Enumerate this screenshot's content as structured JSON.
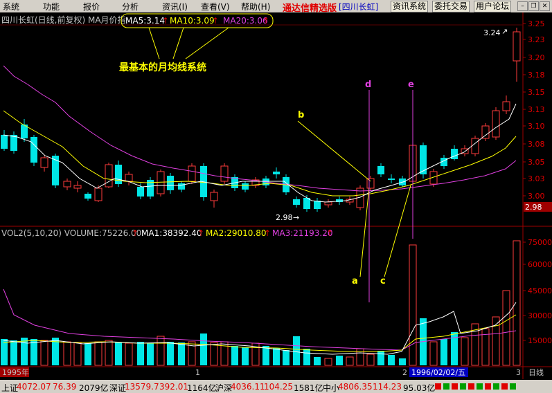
{
  "menu": {
    "items": [
      "系统",
      "功能",
      "报价",
      "分析",
      "资讯(I)",
      "查看(V)",
      "帮助(H)"
    ],
    "title": "通达信精选版",
    "stock": "[四川长虹]",
    "buttons": [
      "资讯系统",
      "委托交易",
      "用户论坛"
    ]
  },
  "chart": {
    "header_left": "四川长虹(日线,前复权) MA月价指",
    "ma5": "MA5:3.14",
    "ma10": "MA10:3.09",
    "ma20": "MA20:3.06",
    "caption": "最基本的月均线系统",
    "label_b": "b",
    "label_d": "d",
    "label_e": "e",
    "label_a": "a",
    "label_c": "c",
    "low_label": "2.98",
    "high_label": "3.24",
    "price_box": "2.98",
    "vol_header": "VOL2(5,10,20) VOLUME:75226.00",
    "vol_ma1": "MA1:38392.40",
    "vol_ma2": "MA2:29010.80",
    "vol_ma3": "MA3:21193.20",
    "year_label": "1995年",
    "date_box": "1996/02/02/五",
    "marker1": "1",
    "marker2": "2",
    "marker3": "3",
    "period_label": "日线",
    "price_ticks": [
      "3.25",
      "3.23",
      "3.20",
      "3.18",
      "3.15",
      "3.13",
      "3.10",
      "3.08",
      "3.05",
      "3.03",
      "3.00"
    ],
    "vol_ticks": [
      "75000",
      "60000",
      "45000",
      "30000",
      "15000"
    ],
    "colors": {
      "up": "#ff3c3c",
      "down": "#00e6e6",
      "ma5": "#ffffff",
      "ma10": "#ffff00",
      "ma20": "#e040e0"
    }
  },
  "status": {
    "sh_label": "上证",
    "sh_val": "4072.07",
    "sh_chg": "76.39",
    "sh_amt": "2079亿",
    "sz_label": "深证",
    "sz_val": "13579.7",
    "sz_chg": "392.01",
    "sz_amt": "1164亿",
    "hs_label": "沪深",
    "hs_val": "4036.11",
    "hs_chg": "104.25",
    "hs_amt": "1581亿",
    "zx_label": "中小",
    "zx_val": "4806.35",
    "zx_chg": "114.23",
    "zx_amt": "95.03亿"
  },
  "chart_data": {
    "type": "candlestick",
    "price_axis": [
      3.25,
      3.23,
      3.2,
      3.18,
      3.15,
      3.13,
      3.1,
      3.08,
      3.05,
      3.03,
      3.0
    ],
    "volume_axis": [
      75000,
      60000,
      45000,
      30000,
      15000
    ],
    "last_close": 2.98,
    "annotated_high": 3.24,
    "annotated_low": 2.98,
    "ma": {
      "MA5": 3.14,
      "MA10": 3.09,
      "MA20": 3.06
    },
    "volume": {
      "VOLUME": 75226.0,
      "MA1": 38392.4,
      "MA2": 29010.8,
      "MA3": 21193.2
    },
    "date": "1996/02/02"
  }
}
